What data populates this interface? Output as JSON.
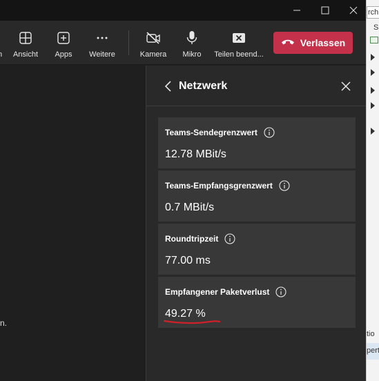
{
  "toolbar": {
    "buttons": [
      {
        "label": "n",
        "icon": "partial-icon"
      },
      {
        "label": "Ansicht",
        "icon": "grid-icon"
      },
      {
        "label": "Apps",
        "icon": "plus-box-icon"
      },
      {
        "label": "Weitere",
        "icon": "more-icon"
      },
      {
        "label": "Kamera",
        "icon": "camera-off-icon"
      },
      {
        "label": "Mikro",
        "icon": "microphone-icon"
      },
      {
        "label": "Teilen beend...",
        "icon": "stop-share-icon"
      }
    ],
    "leave_label": "Verlassen",
    "leave_color": "#c4314b"
  },
  "stage": {
    "partial_text": "n."
  },
  "panel": {
    "title": "Netzwerk",
    "metrics": [
      {
        "label": "Teams-Sendegrenzwert",
        "value": "12.78 MBit/s"
      },
      {
        "label": "Teams-Empfangsgrenzwert",
        "value": "0.7 MBit/s"
      },
      {
        "label": "Roundtripzeit",
        "value": "77.00 ms"
      },
      {
        "label": "Empfangener Paketverlust",
        "value": "49.27 %"
      }
    ],
    "annotation_color": "#d0202a"
  },
  "background_window": {
    "texts": [
      "rch",
      "S",
      "tio",
      "pert"
    ]
  }
}
